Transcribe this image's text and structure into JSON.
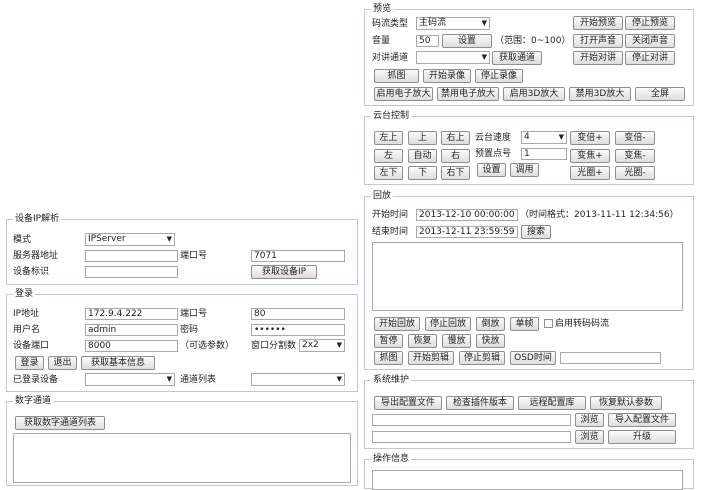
{
  "preview": {
    "legend": "预览",
    "stream_type_label": "码流类型",
    "stream_type_value": "主码流",
    "volume_label": "音量",
    "volume_value": "50",
    "volume_set": "设置",
    "volume_range": "（范围：0~100）",
    "talk_channel_label": "对讲通道",
    "talk_channel_value": "",
    "get_channel": "获取通道",
    "start_preview": "开始预览",
    "stop_preview": "停止预览",
    "open_sound": "打开声音",
    "close_sound": "关闭声音",
    "start_talk": "开始对讲",
    "stop_talk": "停止对讲",
    "capture": "抓图",
    "start_record": "开始录像",
    "stop_record": "停止录像",
    "enable_ezoom": "启用电子放大",
    "disable_ezoom": "禁用电子放大",
    "enable_3d": "启用3D放大",
    "disable_3d": "禁用3D放大",
    "fullscreen": "全屏"
  },
  "ptz": {
    "legend": "云台控制",
    "up_left": "左上",
    "up": "上",
    "up_right": "右上",
    "left": "左",
    "auto": "自动",
    "right": "右",
    "down_left": "左下",
    "down": "下",
    "down_right": "右下",
    "speed_label": "云台速度",
    "speed_value": "4",
    "preset_label": "预置点号",
    "preset_value": "1",
    "set": "设置",
    "call": "调用",
    "zoom_in": "变倍+",
    "zoom_out": "变倍-",
    "focus_in": "变焦+",
    "focus_out": "变焦-",
    "iris_in": "光圈+",
    "iris_out": "光圈-"
  },
  "playback": {
    "legend": "回放",
    "start_label": "开始时间",
    "start_value": "2013-12-10 00:00:00",
    "time_format": "（时间格式：2013-11-11 12:34:56）",
    "end_label": "结束时间",
    "end_value": "2013-12-11 23:59:59",
    "search": "搜索",
    "start_playback": "开始回放",
    "stop_playback": "停止回放",
    "reverse": "倒放",
    "single_frame": "单帧",
    "transcode_label": "启用转码码流",
    "pause": "暂停",
    "resume": "恢复",
    "slow": "慢放",
    "fast": "快放",
    "capture": "抓图",
    "start_clip": "开始剪辑",
    "stop_clip": "停止剪辑",
    "osd_time": "OSD时间"
  },
  "maintenance": {
    "legend": "系统维护",
    "export_config": "导出配置文件",
    "check_plugin": "检查插件版本",
    "remote_config": "远程配置库",
    "restore_default": "恢复默认参数",
    "browse1": "浏览",
    "import_config": "导入配置文件",
    "browse2": "浏览",
    "upgrade": "升级"
  },
  "op_info": {
    "legend": "操作信息"
  },
  "ip_parse": {
    "legend": "设备IP解析",
    "mode_label": "模式",
    "mode_value": "IPServer",
    "server_label": "服务器地址",
    "port_label": "端口号",
    "port_value": "7071",
    "device_id_label": "设备标识",
    "get_ip": "获取设备IP"
  },
  "login": {
    "legend": "登录",
    "ip_label": "IP地址",
    "ip_value": "172.9.4.222",
    "port_label": "端口号",
    "port_value": "80",
    "user_label": "用户名",
    "user_value": "admin",
    "password_label": "密码",
    "password_value": "••••••",
    "device_port_label": "设备端口",
    "device_port_value": "8000",
    "optional_hint": "（可选参数）",
    "window_split_label": "窗口分割数",
    "window_split_value": "2x2",
    "login_btn": "登录",
    "logout_btn": "退出",
    "get_info_btn": "获取基本信息",
    "logged_devices_label": "已登录设备",
    "channel_list_label": "通道列表"
  },
  "digital": {
    "legend": "数字通道",
    "get_list": "获取数字通道列表"
  }
}
